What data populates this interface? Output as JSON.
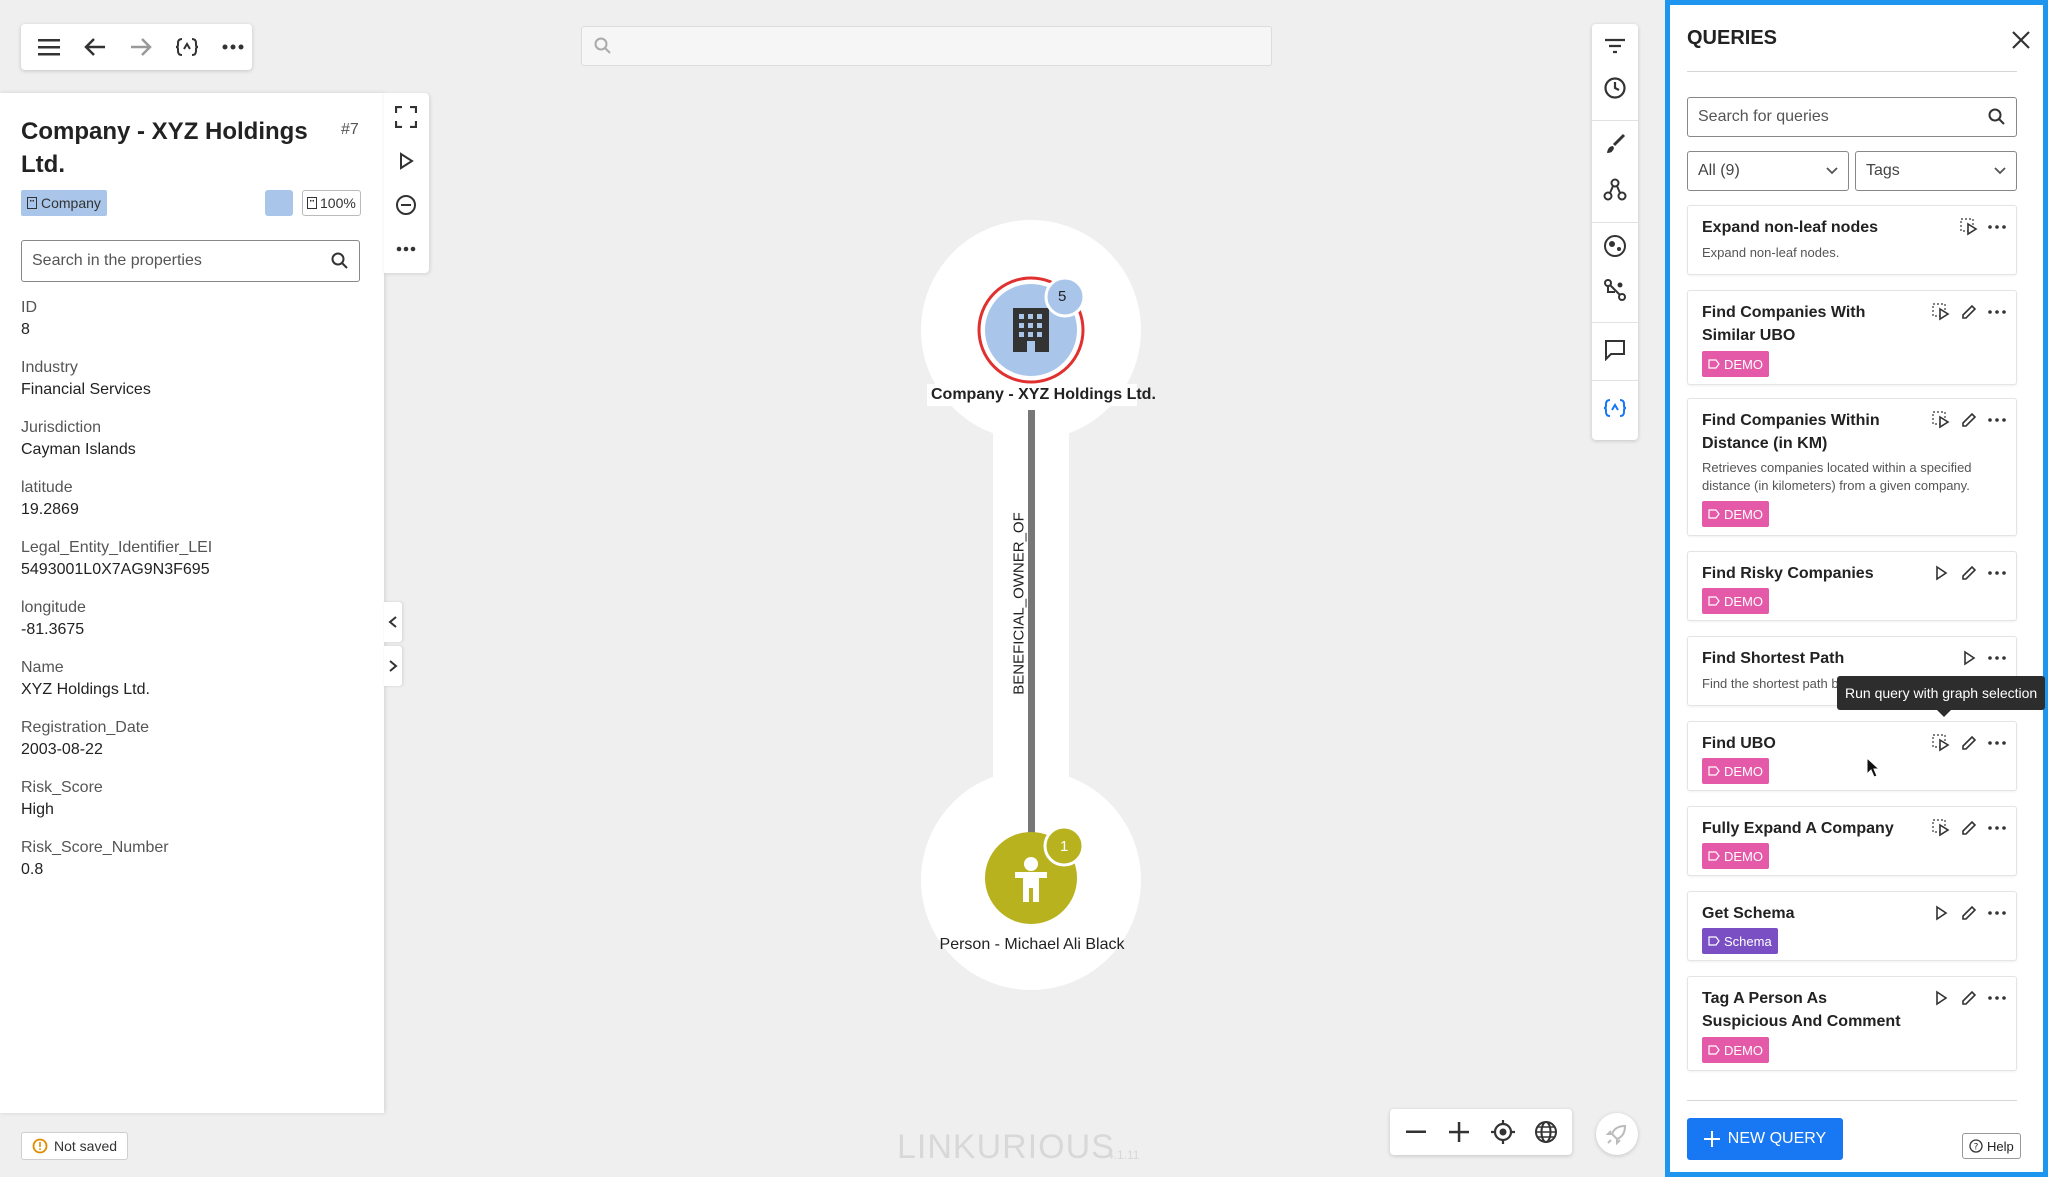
{
  "toolbar": {
    "icons": [
      "menu-icon",
      "back-arrow-icon",
      "forward-arrow-icon",
      "query-icon",
      "more-icon"
    ]
  },
  "graph_search": {
    "placeholder": ""
  },
  "node_panel": {
    "title": "Company - XYZ Holdings Ltd.",
    "id_label": "#7",
    "category": "Company",
    "color": "#a9c6ea",
    "zoom": "100%",
    "search_placeholder": "Search in the properties",
    "properties": [
      {
        "key": "ID",
        "value": "8"
      },
      {
        "key": "Industry",
        "value": "Financial Services"
      },
      {
        "key": "Jurisdiction",
        "value": "Cayman Islands"
      },
      {
        "key": "latitude",
        "value": "19.2869"
      },
      {
        "key": "Legal_Entity_Identifier_LEI",
        "value": "5493001L0X7AG9N3F695"
      },
      {
        "key": "longitude",
        "value": "-81.3675"
      },
      {
        "key": "Name",
        "value": "XYZ Holdings Ltd."
      },
      {
        "key": "Registration_Date",
        "value": "2003-08-22"
      },
      {
        "key": "Risk_Score",
        "value": "High"
      },
      {
        "key": "Risk_Score_Number",
        "value": "0.8"
      }
    ]
  },
  "status": {
    "not_saved": "Not saved"
  },
  "graph": {
    "company_node": {
      "label": "Company - XYZ Holdings Ltd.",
      "count": "5",
      "color": "#a9c6ea"
    },
    "person_node": {
      "label": "Person - Michael Ali Black",
      "count": "1",
      "color": "#b8b21e"
    },
    "edge_label": "BENEFICIAL_OWNER_OF"
  },
  "brand": {
    "name": "LINKURIOUS",
    "version": "4.1.11"
  },
  "queries_panel": {
    "title": "QUERIES",
    "search_placeholder": "Search for queries",
    "filter_all": "All (9)",
    "filter_tags": "Tags",
    "new_query": "NEW QUERY",
    "help": "Help",
    "tooltip": "Run query with graph selection",
    "accent": "#1e96f0",
    "items": [
      {
        "name": "Expand non-leaf nodes",
        "desc": "Expand non-leaf nodes.",
        "tag": "",
        "editable": false,
        "run_selection": true
      },
      {
        "name": "Find Companies With Similar UBO",
        "desc": "",
        "tag": "DEMO",
        "editable": true,
        "run_selection": true
      },
      {
        "name": "Find Companies Within Distance (in KM)",
        "desc": "Retrieves companies located within a specified distance (in kilometers) from a given company.",
        "tag": "DEMO",
        "editable": true,
        "run_selection": true
      },
      {
        "name": "Find Risky Companies",
        "desc": "",
        "tag": "DEMO",
        "editable": true,
        "run_selection": false
      },
      {
        "name": "Find Shortest Path",
        "desc": "Find the shortest path between two nodes",
        "tag": "",
        "editable": false,
        "run_selection": false
      },
      {
        "name": "Find UBO",
        "desc": "",
        "tag": "DEMO",
        "editable": true,
        "run_selection": true
      },
      {
        "name": "Fully Expand A Company",
        "desc": "",
        "tag": "DEMO",
        "editable": true,
        "run_selection": true
      },
      {
        "name": "Get Schema",
        "desc": "",
        "tag": "Schema",
        "editable": true,
        "run_selection": false
      },
      {
        "name": "Tag A Person As Suspicious And Comment",
        "desc": "",
        "tag": "DEMO",
        "editable": true,
        "run_selection": false
      }
    ]
  }
}
